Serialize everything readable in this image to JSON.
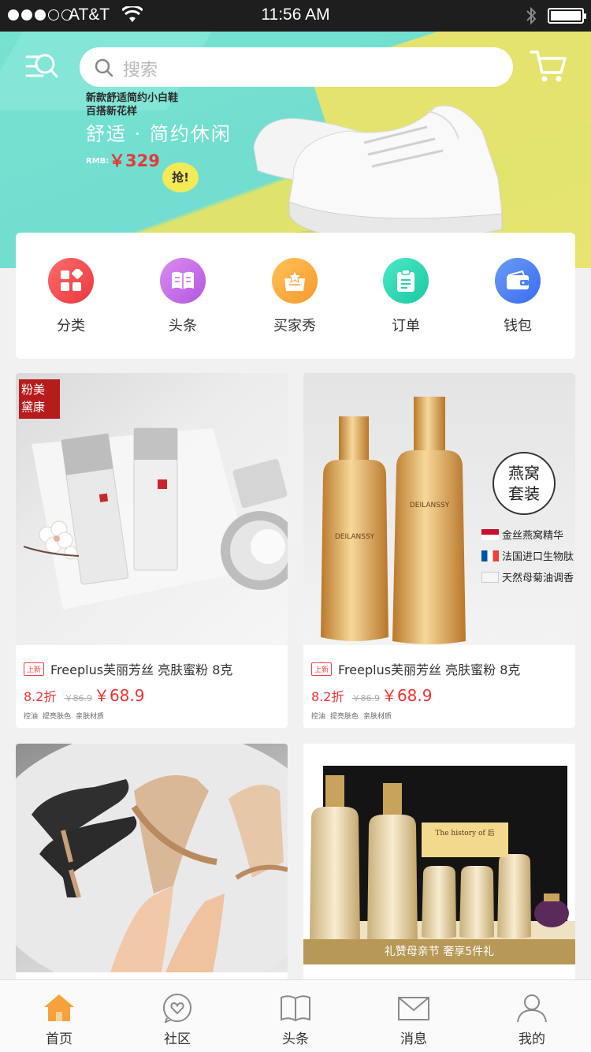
{
  "status_bar": {
    "carrier": "AT&T",
    "time": "11:56 AM"
  },
  "header": {
    "search_placeholder": "搜索"
  },
  "banner": {
    "line1": "新款舒适简约小白鞋",
    "line2": "百搭新花样",
    "slogan": "舒适 · 简约休闲",
    "price_label": "RMB:",
    "price": "￥329",
    "grab_label": "抢!"
  },
  "categories": [
    {
      "label": "分类",
      "icon": "grid-icon",
      "color_from": "#ff6b6b",
      "color_to": "#e8383f"
    },
    {
      "label": "头条",
      "icon": "book-icon",
      "color_from": "#d98cf0",
      "color_to": "#b457e0"
    },
    {
      "label": "买家秀",
      "icon": "box-star-icon",
      "color_from": "#ffc25a",
      "color_to": "#f79a2a"
    },
    {
      "label": "订单",
      "icon": "clipboard-icon",
      "color_from": "#4ee8c6",
      "color_to": "#18c9a2"
    },
    {
      "label": "钱包",
      "icon": "wallet-icon",
      "color_from": "#6a9cf8",
      "color_to": "#3a6cf0"
    }
  ],
  "products": [
    {
      "tag": "上新",
      "title": "Freeplus芙丽芳丝 亮肤蜜粉 8克",
      "discount": "8.2折",
      "orig_price": "￥86.9",
      "price": "￥68.9",
      "tags": [
        "控油",
        "提亮肤色",
        "亲肤材质"
      ],
      "stamp": [
        "粉美",
        "黛康"
      ]
    },
    {
      "tag": "上新",
      "title": "Freeplus芙丽芳丝 亮肤蜜粉 8克",
      "discount": "8.2折",
      "orig_price": "￥86.9",
      "price": "￥68.9",
      "tags": [
        "控油",
        "提亮肤色",
        "亲肤材质"
      ],
      "badge": [
        "燕窝",
        "套装"
      ],
      "features": [
        "金丝燕窝精华",
        "法国进口生物肽",
        "天然母菊油调香"
      ]
    },
    {
      "image": "shoes"
    },
    {
      "gift_text": "礼赞母亲节 奢享5件礼",
      "box_label": "The history of 后"
    }
  ],
  "tab_bar": [
    {
      "label": "首页",
      "icon": "home-icon",
      "active": true
    },
    {
      "label": "社区",
      "icon": "community-heart-icon"
    },
    {
      "label": "头条",
      "icon": "open-book-icon"
    },
    {
      "label": "消息",
      "icon": "mail-icon"
    },
    {
      "label": "我的",
      "icon": "user-icon"
    }
  ],
  "colors": {
    "accent_red": "#e33333",
    "tab_active": "#f7a13b",
    "tab_inactive": "#8a8a8a"
  }
}
